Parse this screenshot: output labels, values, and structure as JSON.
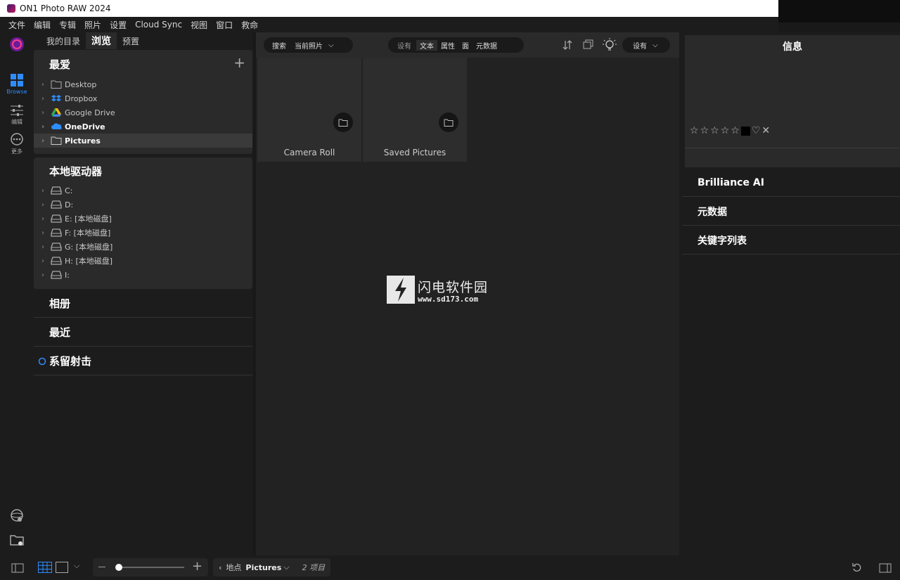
{
  "window": {
    "title": "ON1 Photo RAW 2024"
  },
  "menu": [
    "文件",
    "编辑",
    "专辑",
    "照片",
    "设置",
    "Cloud Sync",
    "视图",
    "窗口",
    "救命"
  ],
  "rail": {
    "browse_label": "Browse",
    "edit_label": "编辑",
    "more_label": "更多"
  },
  "left": {
    "tabs": [
      "我的目录",
      "浏览",
      "预置"
    ],
    "favorites": {
      "title": "最爱",
      "items": [
        {
          "label": "Desktop",
          "icon": "folder-icon"
        },
        {
          "label": "Dropbox",
          "icon": "dropbox-icon"
        },
        {
          "label": "Google Drive",
          "icon": "google-drive-icon"
        },
        {
          "label": "OneDrive",
          "icon": "onedrive-icon"
        },
        {
          "label": "Pictures",
          "icon": "folder-icon"
        }
      ]
    },
    "drives": {
      "title": "本地驱动器",
      "items": [
        "C:",
        "D:",
        "E: [本地磁盘]",
        "F: [本地磁盘]",
        "G: [本地磁盘]",
        "H: [本地磁盘]",
        "I:"
      ]
    },
    "collections": [
      "相册",
      "最近",
      "系留射击"
    ]
  },
  "toolbar": {
    "search_label": "搜索",
    "scope_value": "当前照片",
    "filters": [
      "设有",
      "文本",
      "属性",
      "面",
      "元数据"
    ],
    "settings_label": "设有"
  },
  "thumbs": [
    "Camera Roll",
    "Saved Pictures"
  ],
  "watermark": {
    "text": "闪电软件园",
    "url": "www.sd173.com"
  },
  "right": {
    "info_title": "信息",
    "sections": [
      "Brilliance AI",
      "元数据",
      "关键字列表"
    ]
  },
  "bottom": {
    "location_prefix": "地点",
    "location_value": "Pictures",
    "count": "2 项目"
  }
}
